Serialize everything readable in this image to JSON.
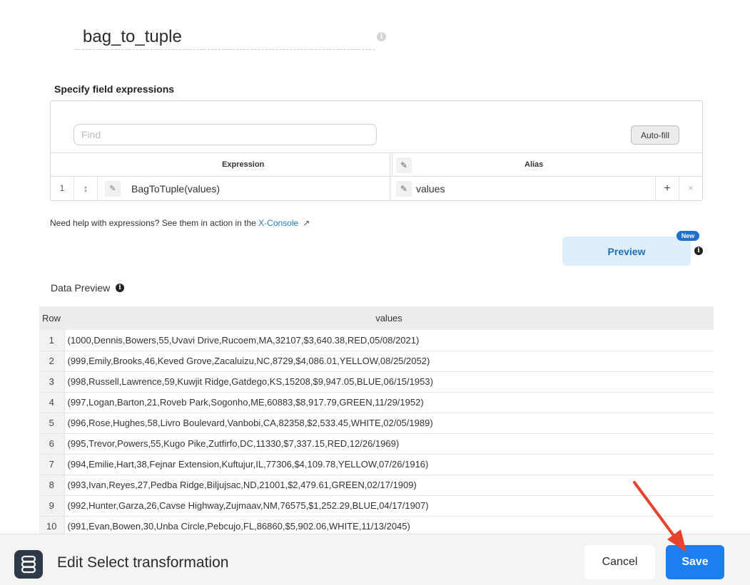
{
  "header": {
    "title": "bag_to_tuple",
    "info_icon": "info-icon"
  },
  "expressions": {
    "heading": "Specify field expressions",
    "find_placeholder": "Find",
    "autofill_label": "Auto-fill",
    "columns": {
      "expression": "Expression",
      "alias": "Alias"
    },
    "rows": [
      {
        "index": "1",
        "expression": "BagToTuple(values)",
        "alias": "values"
      }
    ]
  },
  "help": {
    "text": "Need help with expressions? See them in action in the ",
    "link": "X-Console"
  },
  "preview": {
    "button_label": "Preview",
    "badge": "New"
  },
  "data_preview": {
    "label": "Data Preview",
    "columns": [
      "Row",
      "values"
    ],
    "rows": [
      {
        "row": "1",
        "value": "(1000,Dennis,Bowers,55,Uvavi Drive,Rucoem,MA,32107,$3,640.38,RED,05/08/2021)"
      },
      {
        "row": "2",
        "value": "(999,Emily,Brooks,46,Keved Grove,Zacaluizu,NC,8729,$4,086.01,YELLOW,08/25/2052)"
      },
      {
        "row": "3",
        "value": "(998,Russell,Lawrence,59,Kuwjit Ridge,Gatdego,KS,15208,$9,947.05,BLUE,06/15/1953)"
      },
      {
        "row": "4",
        "value": "(997,Logan,Barton,21,Roveb Park,Sogonho,ME,60883,$8,917.79,GREEN,11/29/1952)"
      },
      {
        "row": "5",
        "value": "(996,Rose,Hughes,58,Livro Boulevard,Vanbobi,CA,82358,$2,533.45,WHITE,02/05/1989)"
      },
      {
        "row": "6",
        "value": "(995,Trevor,Powers,55,Kugo Pike,Zutfirfo,DC,11330,$7,337.15,RED,12/26/1969)"
      },
      {
        "row": "7",
        "value": "(994,Emilie,Hart,38,Fejnar Extension,Kuftujur,IL,77306,$4,109.78,YELLOW,07/26/1916)"
      },
      {
        "row": "8",
        "value": "(993,Ivan,Reyes,27,Pedba Ridge,Biljujsac,ND,21001,$2,479.61,GREEN,02/17/1909)"
      },
      {
        "row": "9",
        "value": "(992,Hunter,Garza,26,Cavse Highway,Zujmaav,NM,76575,$1,252.29,BLUE,04/17/1907)"
      },
      {
        "row": "10",
        "value": "(991,Evan,Bowen,30,Unba Circle,Pebcujo,FL,86860,$5,902.06,WHITE,11/13/2045)"
      }
    ]
  },
  "footer": {
    "title": "Edit Select transformation",
    "cancel_label": "Cancel",
    "save_label": "Save"
  },
  "colors": {
    "primary": "#1c7ef0",
    "preview_bg": "#deeefc",
    "link": "#1f7ec4",
    "annotation_arrow": "#e8432c"
  }
}
